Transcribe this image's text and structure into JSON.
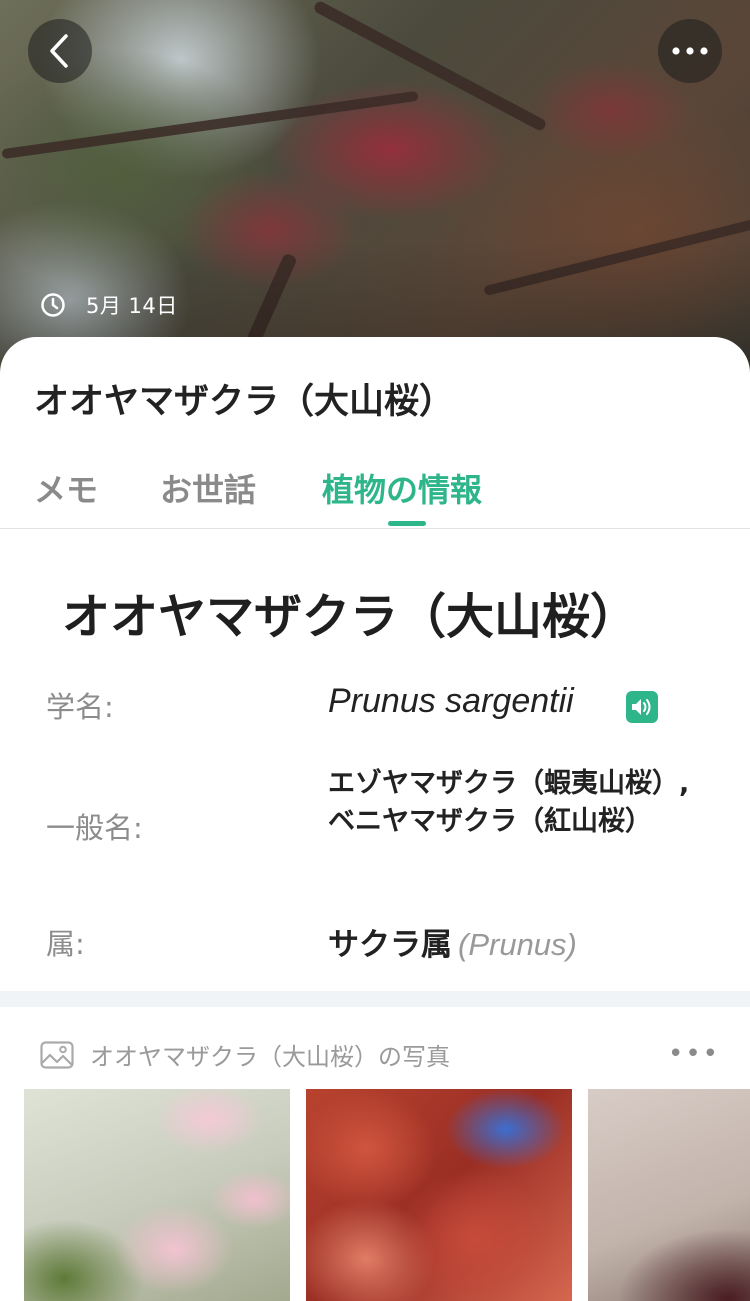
{
  "header": {
    "date": "5月 14日",
    "back_icon": "chevron-left-icon",
    "more_icon": "more-horizontal-icon",
    "clock_icon": "clock-icon"
  },
  "plant": {
    "title": "オオヤマザクラ（大山桜）"
  },
  "tabs": [
    {
      "label": "メモ",
      "active": false
    },
    {
      "label": "お世話",
      "active": false
    },
    {
      "label": "植物の情報",
      "active": true
    }
  ],
  "info": {
    "heading": "オオヤマザクラ（大山桜）",
    "scientific_name_label": "学名:",
    "scientific_name": "Prunus sargentii",
    "common_name_label": "一般名:",
    "common_names": "エゾヤマザクラ（蝦夷山桜）, ベニヤマザクラ（紅山桜）",
    "genus_label": "属:",
    "genus": "サクラ属",
    "genus_latin": "(Prunus)"
  },
  "photos": {
    "header": "オオヤマザクラ（大山桜）の写真",
    "more": "•••"
  },
  "colors": {
    "accent": "#2fb58a",
    "muted_text": "#8c8c8c"
  }
}
